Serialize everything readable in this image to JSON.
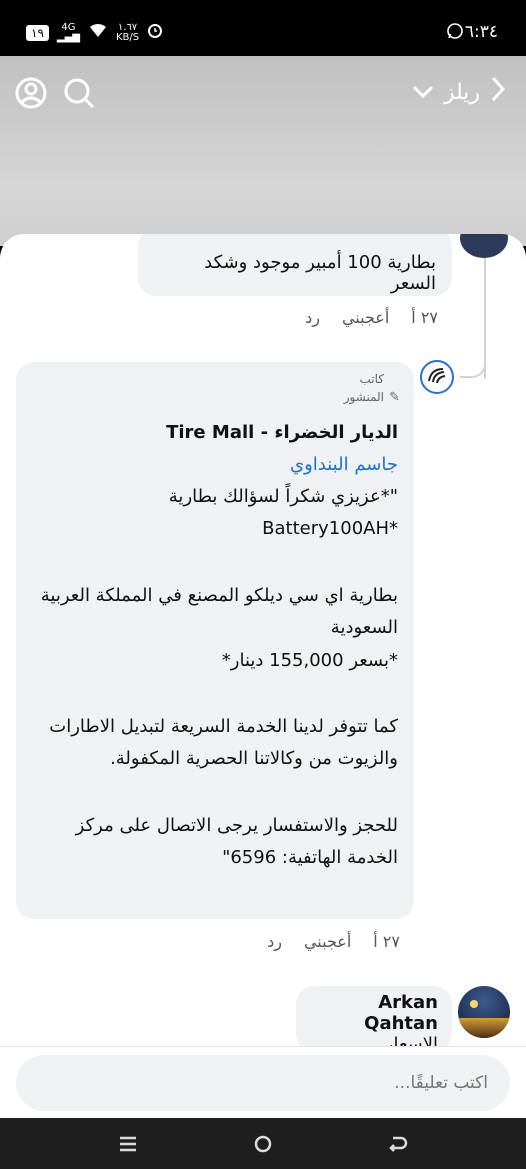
{
  "status_bar": {
    "time": "٦:٣٤",
    "battery": "١٩",
    "network": "4G",
    "speed_value": "١.٦٧",
    "speed_unit": "KB/S"
  },
  "header": {
    "title": "ريلز",
    "icons": [
      "back-chevron-icon",
      "chevron-down-icon",
      "search-icon",
      "profile-icon"
    ]
  },
  "comments": [
    {
      "text": "بطارية 100 أمبير موجود وشكد السعر",
      "time": "٢٧ أ",
      "like_label": "أعجبني",
      "reply_label": "رد"
    },
    {
      "author_label_1": "كاتب",
      "author_label_2": "المنشور",
      "page_name": "الديار الخضراء - Tire Mall",
      "mention": "جاسم البنداوي",
      "lines": [
        "\"*عزيزي شكراً لسؤالك بطارية",
        "*Battery100AH",
        "بطارية اي سي ديلكو المصنع في المملكة العربية",
        "السعودية",
        "*بسعر 155,000 دينار*",
        "كما تتوفر لدينا الخدمة السريعة لتبديل الاطارات",
        "والزيوت من وكالاتنا الحصرية المكفولة.",
        "للحجز والاستفسار يرجى الاتصال على مركز",
        "الخدمة الهاتفية: 6596\""
      ],
      "time": "٢٧ أ",
      "like_label": "أعجبني",
      "reply_label": "رد"
    },
    {
      "author": "Arkan Qahtan",
      "text": "الاسعار"
    }
  ],
  "composer": {
    "placeholder": "اكتب تعليقًا..."
  },
  "colors": {
    "mention": "#1a73c8",
    "bubble": "#eff1f4",
    "avatar_ring": "#2b6fd1"
  }
}
